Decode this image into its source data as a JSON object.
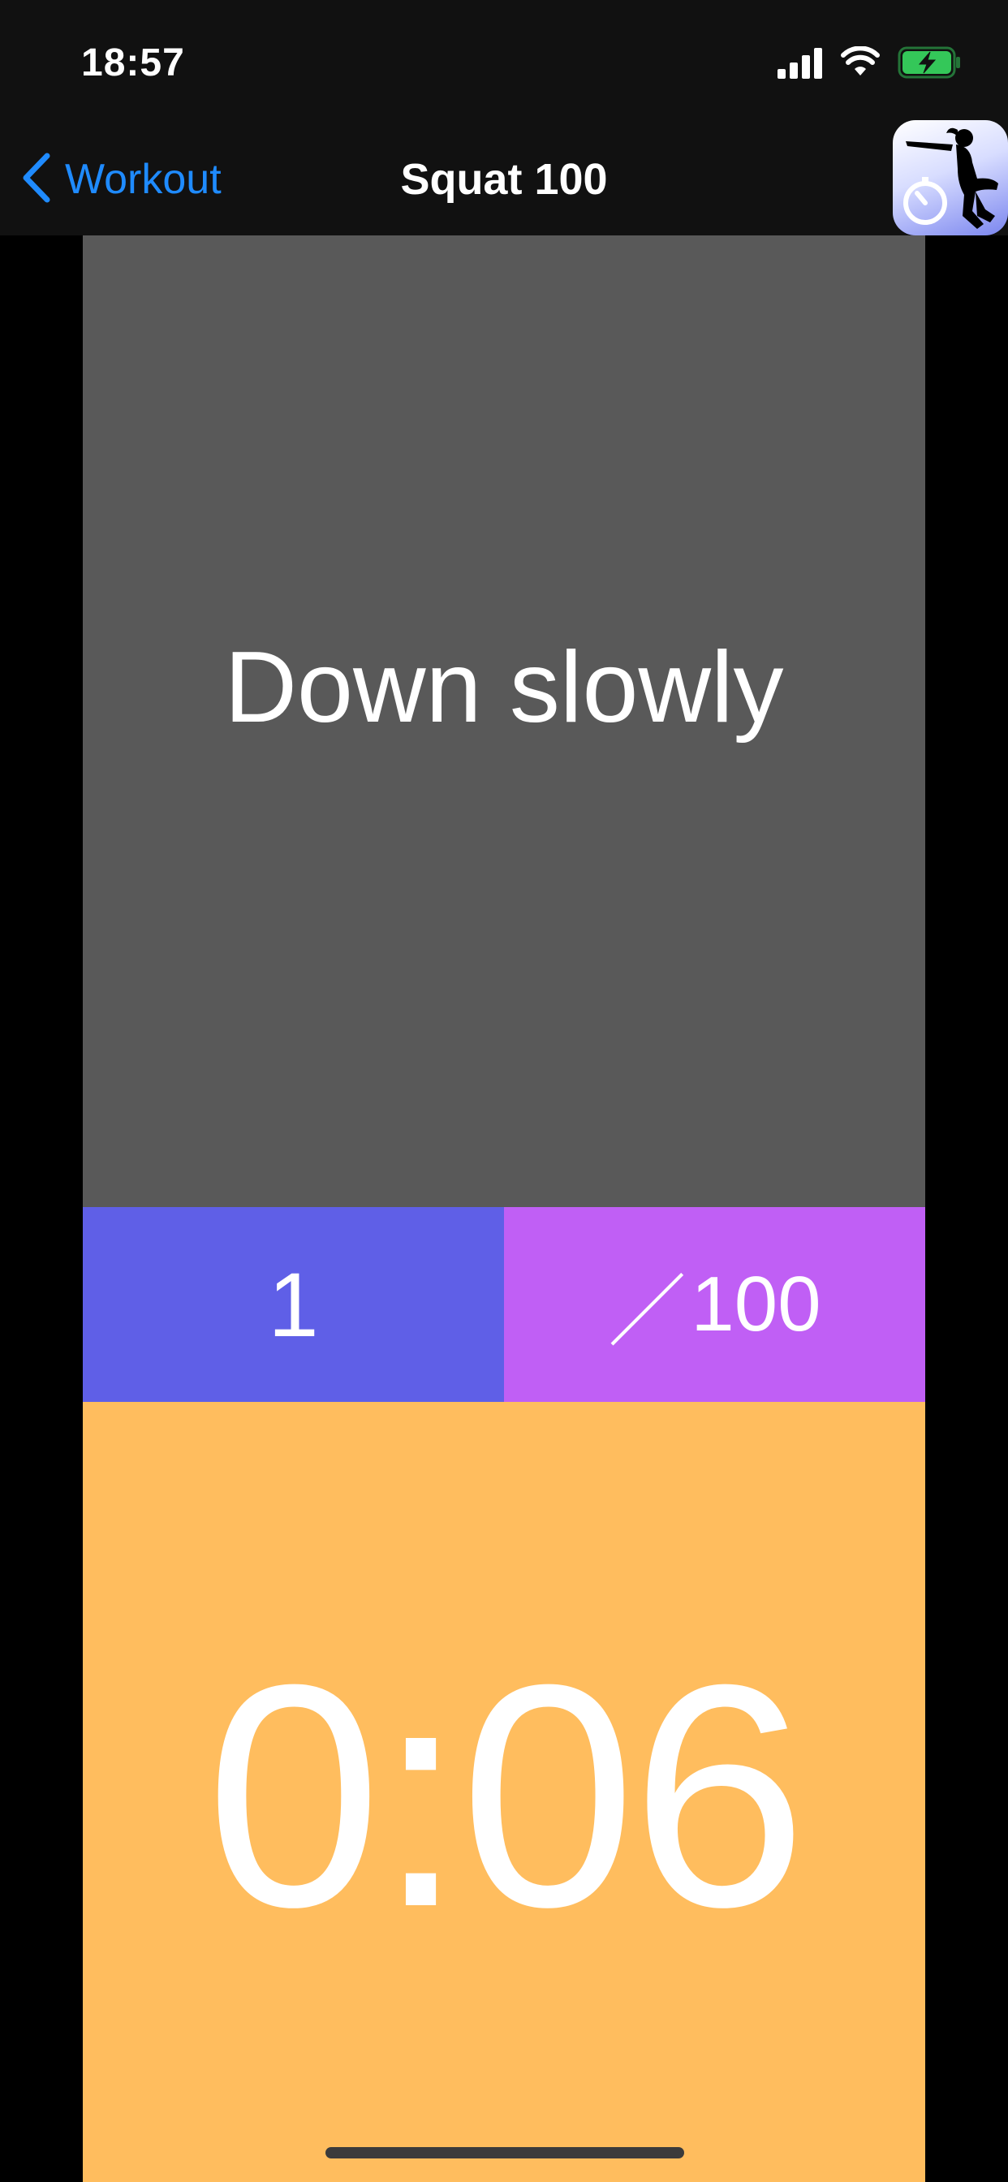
{
  "status_bar": {
    "time": "18:57",
    "icons": [
      "cellular-signal-icon",
      "wifi-icon",
      "battery-charging-icon"
    ],
    "battery_color": "#34c759"
  },
  "nav": {
    "back_label": "Workout",
    "title": "Squat 100",
    "accent_color": "#1f8bff",
    "app_icon": "squat-timer-app-icon"
  },
  "instruction": {
    "text": "Down slowly",
    "bg_color": "#595959"
  },
  "counter": {
    "current": "1",
    "separator": "／",
    "total": "100",
    "current_bg": "#5f5fe7",
    "total_bg": "#c05ff5"
  },
  "timer": {
    "value": "0:06",
    "bg_color": "#ffbd5e"
  }
}
